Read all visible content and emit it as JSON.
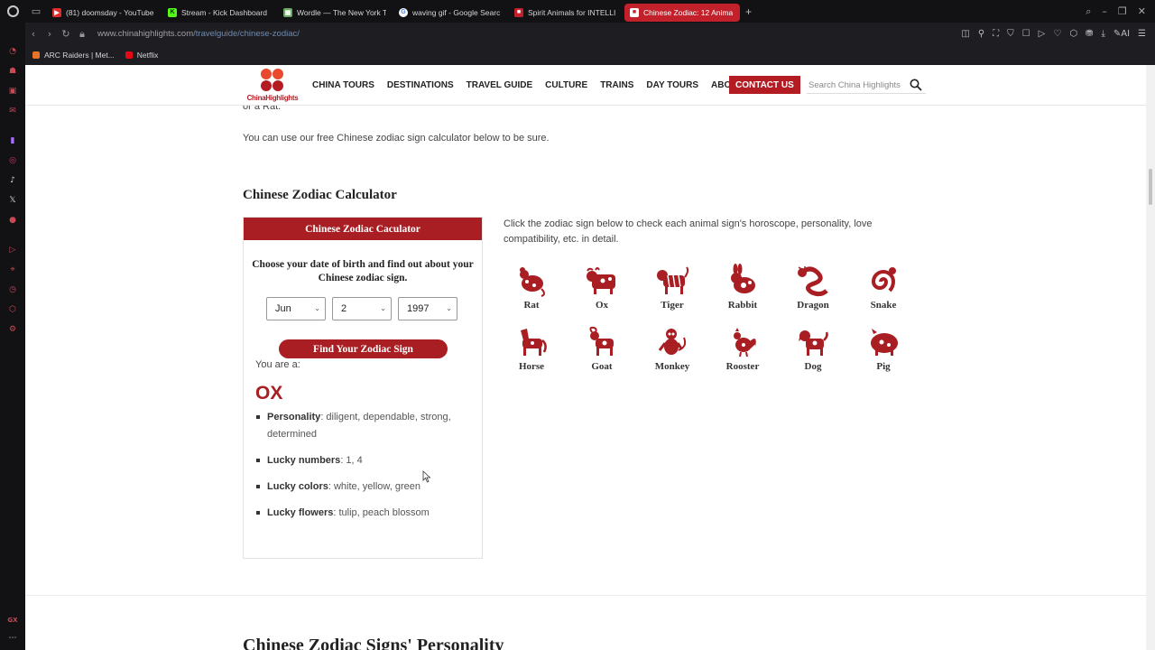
{
  "browser": {
    "tabs": [
      {
        "title": "(81) doomsday - YouTube",
        "color": "#e02b2b",
        "glyph": "▶"
      },
      {
        "title": "Stream - Kick Dashboard",
        "color": "#53fc18",
        "glyph": "K"
      },
      {
        "title": "Wordle — The New York T",
        "color": "#6aaa64",
        "glyph": "▦"
      },
      {
        "title": "waving gif - Google Searc",
        "color": "#ffffff",
        "glyph": "G"
      },
      {
        "title": "Spirit Animals for INTELLI",
        "color": "#c2212b",
        "glyph": "■"
      },
      {
        "title": "Chinese Zodiac: 12 Anima",
        "color": "#c2212b",
        "glyph": "■"
      }
    ],
    "url_host": "www.chinahighlights.com",
    "url_path": "/travelguide/chinese-zodiac/",
    "bookmarks": [
      {
        "label": "ARC Raiders | Met...",
        "color": "#e8742a"
      },
      {
        "label": "Netflix",
        "color": "#e50914"
      }
    ]
  },
  "site": {
    "logo_text": "ChinaHighlights",
    "nav": [
      "CHINA TOURS",
      "DESTINATIONS",
      "TRAVEL GUIDE",
      "CULTURE",
      "TRAINS",
      "DAY TOURS",
      "ABOUT US"
    ],
    "contact": "CONTACT US",
    "search_placeholder": "Search China Highlights"
  },
  "content": {
    "prev_text": "or a Rat.",
    "use_calc": "You can use our free Chinese zodiac sign calculator below to be sure.",
    "section_title": "Chinese Zodiac Calculator",
    "next_section_title": "Chinese Zodiac Signs' Personality",
    "calculator": {
      "header": "Chinese Zodiac Caculator",
      "intro": "Choose your date of birth and find out about your Chinese zodiac sign.",
      "month": "Jun",
      "day": "2",
      "year": "1997",
      "button": "Find Your Zodiac Sign",
      "you_are": "You are a:",
      "result": "OX",
      "traits": [
        {
          "label": "Personality",
          "value": ": diligent, dependable, strong, determined"
        },
        {
          "label": "Lucky numbers",
          "value": ": 1, 4"
        },
        {
          "label": "Lucky colors",
          "value": ": white, yellow, green"
        },
        {
          "label": "Lucky flowers",
          "value": ": tulip, peach blossom"
        }
      ]
    },
    "zodiac_intro": "Click the zodiac sign below to check each animal sign's horoscope, personality, love compatibility, etc. in detail.",
    "signs": [
      "Rat",
      "Ox",
      "Tiger",
      "Rabbit",
      "Dragon",
      "Snake",
      "Horse",
      "Goat",
      "Monkey",
      "Rooster",
      "Dog",
      "Pig"
    ]
  },
  "colors": {
    "brand_red": "#a81e23",
    "active_tab": "#c2212b"
  }
}
